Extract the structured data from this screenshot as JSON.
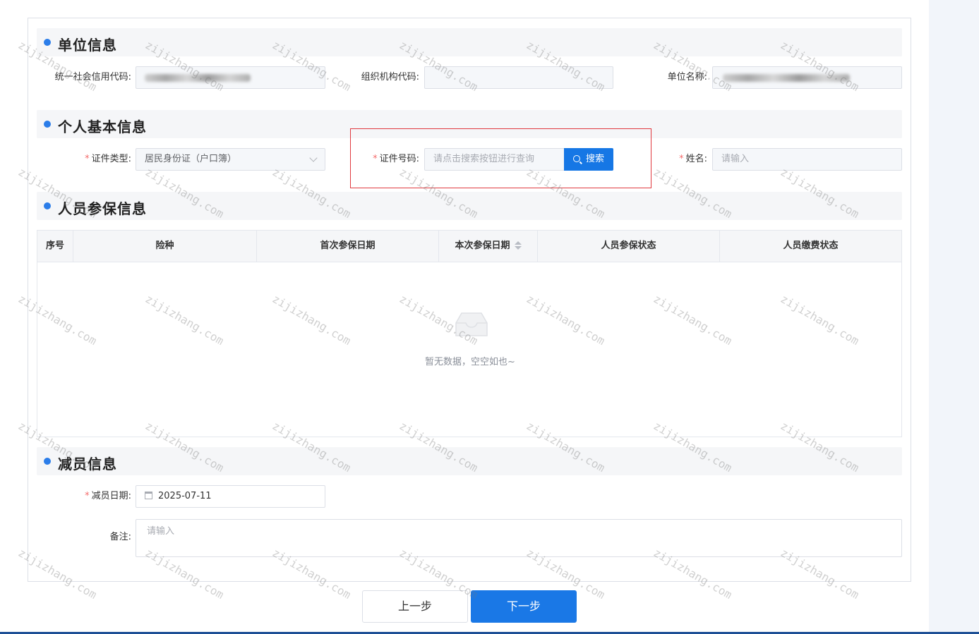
{
  "sections": {
    "unit": "单位信息",
    "personal": "个人基本信息",
    "insurance": "人员参保信息",
    "reduction": "减员信息"
  },
  "unit_info": {
    "credit_code_label": "统一社会信用代码:",
    "org_code_label": "组织机构代码:",
    "unit_name_label": "单位名称:"
  },
  "personal_info": {
    "id_type_label": "证件类型:",
    "id_type_value": "居民身份证（户口簿）",
    "id_number_label": "证件号码:",
    "id_number_placeholder": "请点击搜索按钮进行查询",
    "search_button": "搜索",
    "name_label": "姓名:",
    "name_placeholder": "请输入"
  },
  "table": {
    "columns": [
      "序号",
      "险种",
      "首次参保日期",
      "本次参保日期",
      "人员参保状态",
      "人员缴费状态"
    ],
    "empty_text": "暂无数据，空空如也~"
  },
  "reduction_info": {
    "date_label": "减员日期:",
    "date_value": "2025-07-11",
    "remark_label": "备注:",
    "remark_placeholder": "请输入"
  },
  "buttons": {
    "prev": "上一步",
    "next": "下一步"
  },
  "watermark": "zijizhang.com",
  "colors": {
    "primary": "#1677e5",
    "required": "#f56c6c",
    "highlight_box": "#e0393e"
  }
}
